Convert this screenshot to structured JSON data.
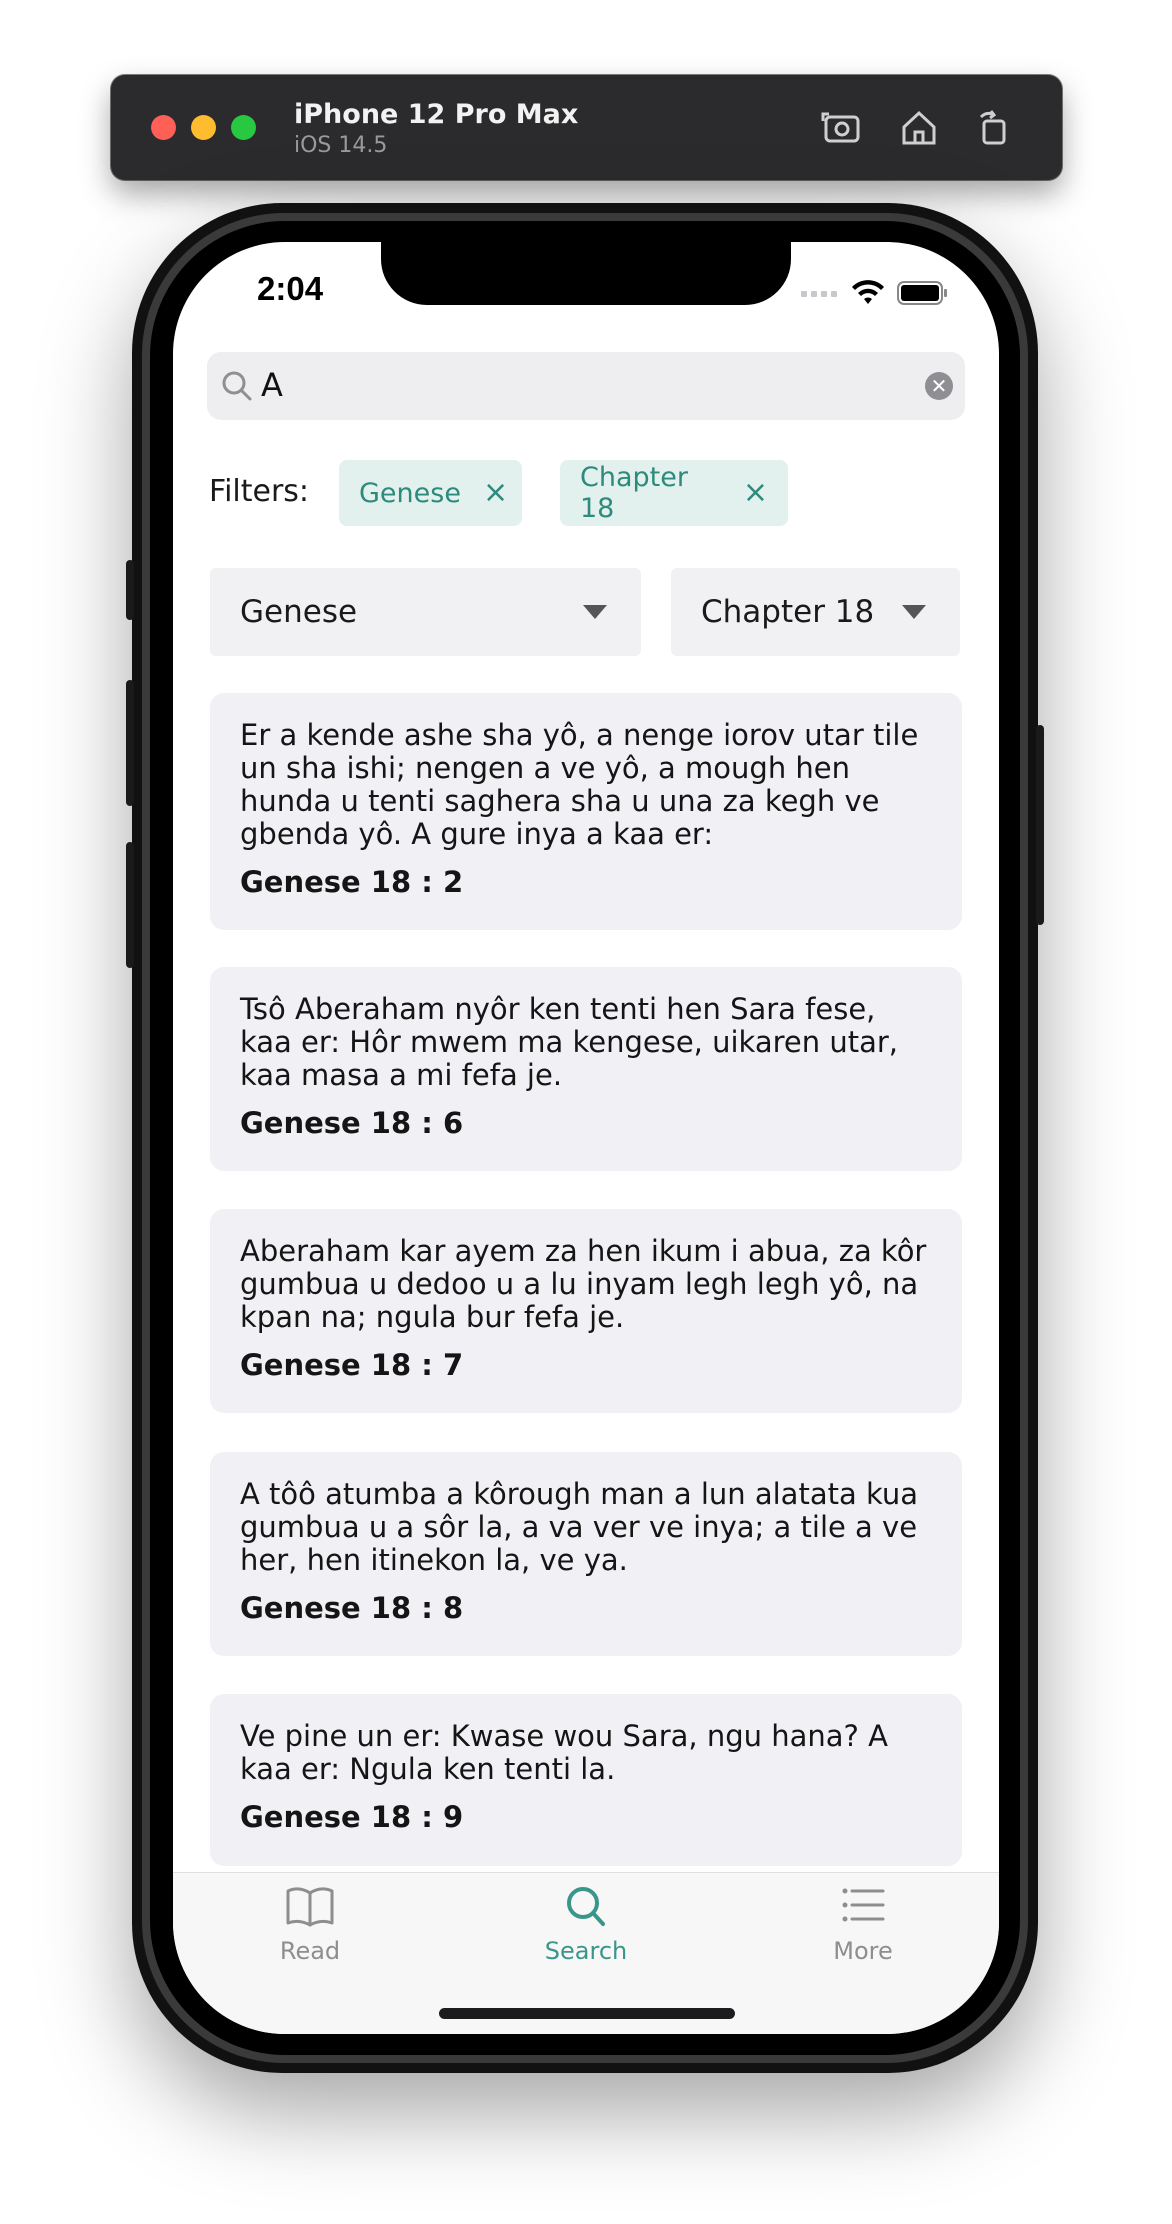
{
  "simulator": {
    "device": "iPhone 12 Pro Max",
    "os": "iOS 14.5",
    "icons": [
      "screenshot-icon",
      "home-icon",
      "rotate-icon"
    ]
  },
  "status_bar": {
    "time": "2:04",
    "icons": [
      "signal-icon",
      "wifi-icon",
      "battery-icon"
    ]
  },
  "search": {
    "query": "A",
    "icon": "search-icon",
    "clear_icon": "clear-icon"
  },
  "filters": {
    "label": "Filters:",
    "chips": [
      {
        "label": "Genese",
        "remove": "×"
      },
      {
        "label": "Chapter 18",
        "remove": "×"
      }
    ]
  },
  "dropdowns": {
    "book": "Genese",
    "chapter": "Chapter 18"
  },
  "results": [
    {
      "text": "Er a kende ashe sha yô, a nenge iorov utar tile un sha ishi; nengen a ve yô, a mough hen hunda u tenti saghera sha u una za kegh ve gbenda yô. A gure inya a kaa er:",
      "ref": "Genese 18 : 2"
    },
    {
      "text": "Tsô Aberaham nyôr ken tenti hen Sara fese, kaa er: Hôr mwem ma kengese, uikaren utar, kaa masa a mi fefa je.",
      "ref": "Genese 18 : 6"
    },
    {
      "text": "Aberaham kar ayem za hen ikum i abua, za kôr gumbua u dedoo u a lu inyam legh legh yô, na kpan na; ngula bur fefa je.",
      "ref": "Genese 18 : 7"
    },
    {
      "text": "A tôô atumba a kôrough man a lun alatata kua gumbua u a sôr la, a va ver ve inya; a tile a ve her, hen itinekon la, ve ya.",
      "ref": "Genese 18 : 8"
    },
    {
      "text": "Ve pine un er: Kwase wou Sara, ngu hana? A kaa er: Ngula ken tenti la.",
      "ref": "Genese 18 : 9"
    }
  ],
  "tabs": [
    {
      "label": "Read",
      "icon": "book-icon",
      "active": false
    },
    {
      "label": "Search",
      "icon": "search-icon",
      "active": true
    },
    {
      "label": "More",
      "icon": "list-icon",
      "active": false
    }
  ],
  "colors": {
    "accent": "#3a968a",
    "chip_bg": "#e3f1ee",
    "card_bg": "#f1f1f5",
    "tab_inactive": "#8e8e8e"
  }
}
